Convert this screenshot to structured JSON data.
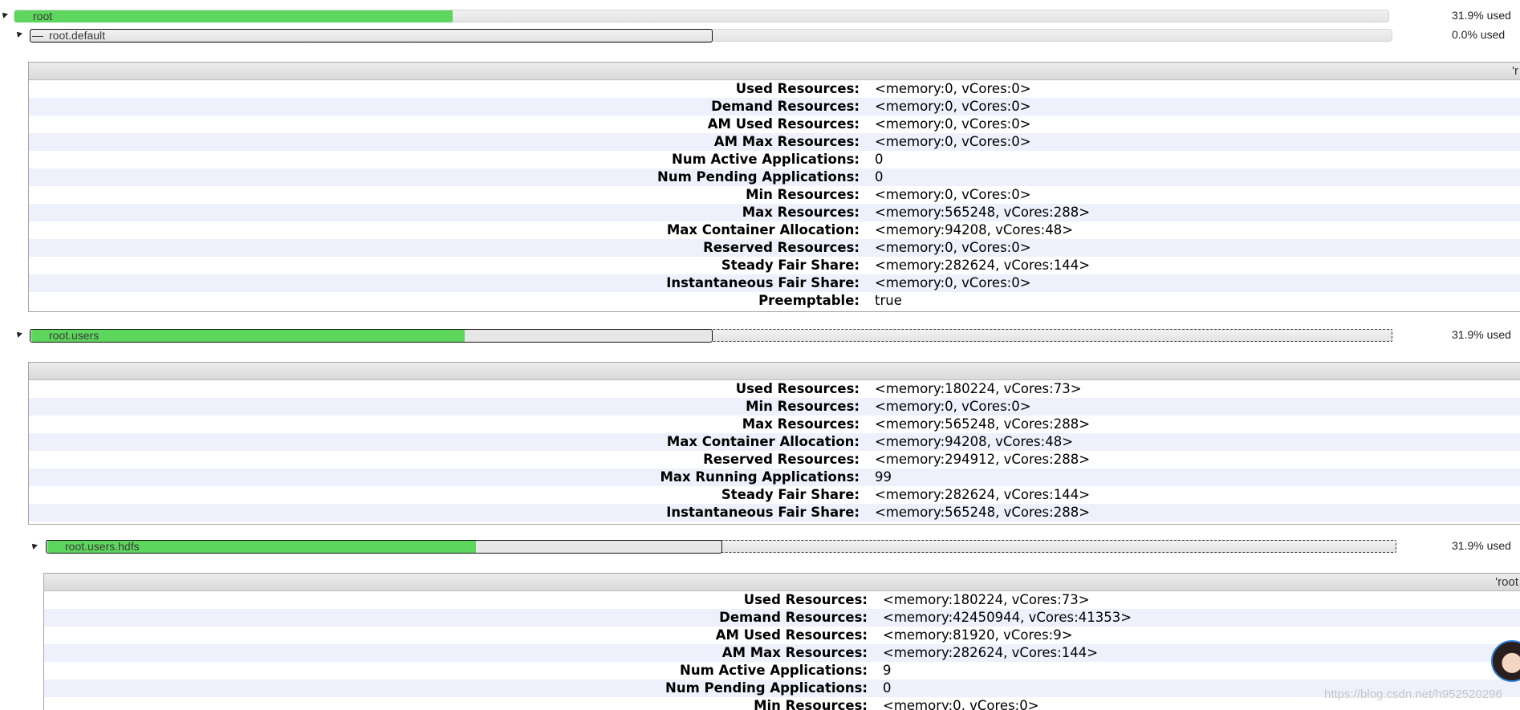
{
  "colors": {
    "used": "#5dd65d",
    "bar_bg": "#e6e6e6",
    "alt_row": "#eef0fb"
  },
  "queues": [
    {
      "name": "root",
      "percent": "31.9% used",
      "used_fraction": 0.319
    },
    {
      "name": "root.default",
      "percent": "0.0% used",
      "used_fraction": 0.0,
      "marker": "—"
    },
    {
      "name": "root.users",
      "percent": "31.9% used",
      "used_fraction": 0.319
    },
    {
      "name": "root.users.hdfs",
      "percent": "31.9% used",
      "used_fraction": 0.319
    }
  ],
  "panels": {
    "default": {
      "header": "'r",
      "rows": [
        {
          "label": "Used Resources:",
          "value": "<memory:0, vCores:0>"
        },
        {
          "label": "Demand Resources:",
          "value": "<memory:0, vCores:0>"
        },
        {
          "label": "AM Used Resources:",
          "value": "<memory:0, vCores:0>"
        },
        {
          "label": "AM Max Resources:",
          "value": "<memory:0, vCores:0>"
        },
        {
          "label": "Num Active Applications:",
          "value": "0"
        },
        {
          "label": "Num Pending Applications:",
          "value": "0"
        },
        {
          "label": "Min Resources:",
          "value": "<memory:0, vCores:0>"
        },
        {
          "label": "Max Resources:",
          "value": "<memory:565248, vCores:288>"
        },
        {
          "label": "Max Container Allocation:",
          "value": "<memory:94208, vCores:48>"
        },
        {
          "label": "Reserved Resources:",
          "value": "<memory:0, vCores:0>"
        },
        {
          "label": "Steady Fair Share:",
          "value": "<memory:282624, vCores:144>"
        },
        {
          "label": "Instantaneous Fair Share:",
          "value": "<memory:0, vCores:0>"
        },
        {
          "label": "Preemptable:",
          "value": "true"
        }
      ]
    },
    "users": {
      "header": "",
      "rows": [
        {
          "label": "Used Resources:",
          "value": "<memory:180224, vCores:73>"
        },
        {
          "label": "Min Resources:",
          "value": "<memory:0, vCores:0>"
        },
        {
          "label": "Max Resources:",
          "value": "<memory:565248, vCores:288>"
        },
        {
          "label": "Max Container Allocation:",
          "value": "<memory:94208, vCores:48>"
        },
        {
          "label": "Reserved Resources:",
          "value": "<memory:294912, vCores:288>"
        },
        {
          "label": "Max Running Applications:",
          "value": "99"
        },
        {
          "label": "Steady Fair Share:",
          "value": "<memory:282624, vCores:144>"
        },
        {
          "label": "Instantaneous Fair Share:",
          "value": "<memory:565248, vCores:288>"
        }
      ]
    },
    "hdfs": {
      "header": "'root",
      "rows": [
        {
          "label": "Used Resources:",
          "value": "<memory:180224, vCores:73>"
        },
        {
          "label": "Demand Resources:",
          "value": "<memory:42450944, vCores:41353>"
        },
        {
          "label": "AM Used Resources:",
          "value": "<memory:81920, vCores:9>"
        },
        {
          "label": "AM Max Resources:",
          "value": "<memory:282624, vCores:144>"
        },
        {
          "label": "Num Active Applications:",
          "value": "9"
        },
        {
          "label": "Num Pending Applications:",
          "value": "0"
        },
        {
          "label": "Min Resources:",
          "value": "<memory:0, vCores:0>"
        }
      ]
    }
  },
  "watermark": "https://blog.csdn.net/h952520296"
}
